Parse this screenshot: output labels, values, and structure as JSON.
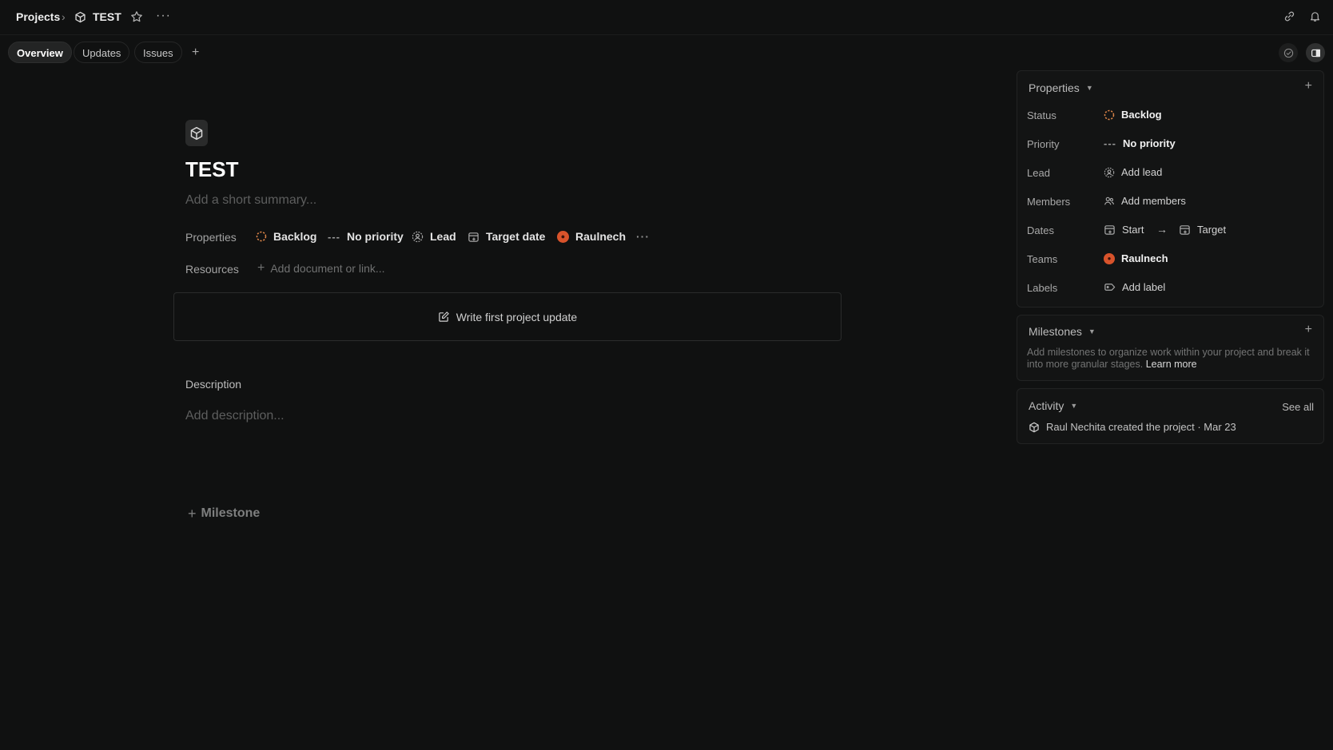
{
  "breadcrumb": {
    "root": "Projects",
    "project": "TEST"
  },
  "tabs": [
    {
      "label": "Overview",
      "active": true
    },
    {
      "label": "Updates",
      "active": false
    },
    {
      "label": "Issues",
      "active": false
    }
  ],
  "project": {
    "title": "TEST",
    "summary_placeholder": "Add a short summary...",
    "properties_label": "Properties",
    "status": "Backlog",
    "priority": "No priority",
    "lead": "Lead",
    "target_date": "Target date",
    "team": "Raulnech",
    "resources_label": "Resources",
    "add_resource": "Add document or link...",
    "write_update": "Write first project update",
    "description_label": "Description",
    "description_placeholder": "Add description...",
    "add_milestone": "Milestone"
  },
  "sidebar": {
    "properties": {
      "title": "Properties",
      "rows": [
        {
          "label": "Status",
          "value": "Backlog"
        },
        {
          "label": "Priority",
          "value": "No priority"
        },
        {
          "label": "Lead",
          "value": "Add lead"
        },
        {
          "label": "Members",
          "value": "Add members"
        },
        {
          "label": "Dates",
          "start": "Start",
          "target": "Target"
        },
        {
          "label": "Teams",
          "value": "Raulnech"
        },
        {
          "label": "Labels",
          "value": "Add label"
        }
      ]
    },
    "milestones": {
      "title": "Milestones",
      "text": "Add milestones to organize work within your project and break it into more granular stages.",
      "link": "Learn more"
    },
    "activity": {
      "title": "Activity",
      "see_all": "See all",
      "entry": "Raul Nechita created the project · Mar 23"
    }
  },
  "colors": {
    "background": "#101111",
    "status_backlog": "#e2884a",
    "team_avatar": "#d8532b"
  }
}
